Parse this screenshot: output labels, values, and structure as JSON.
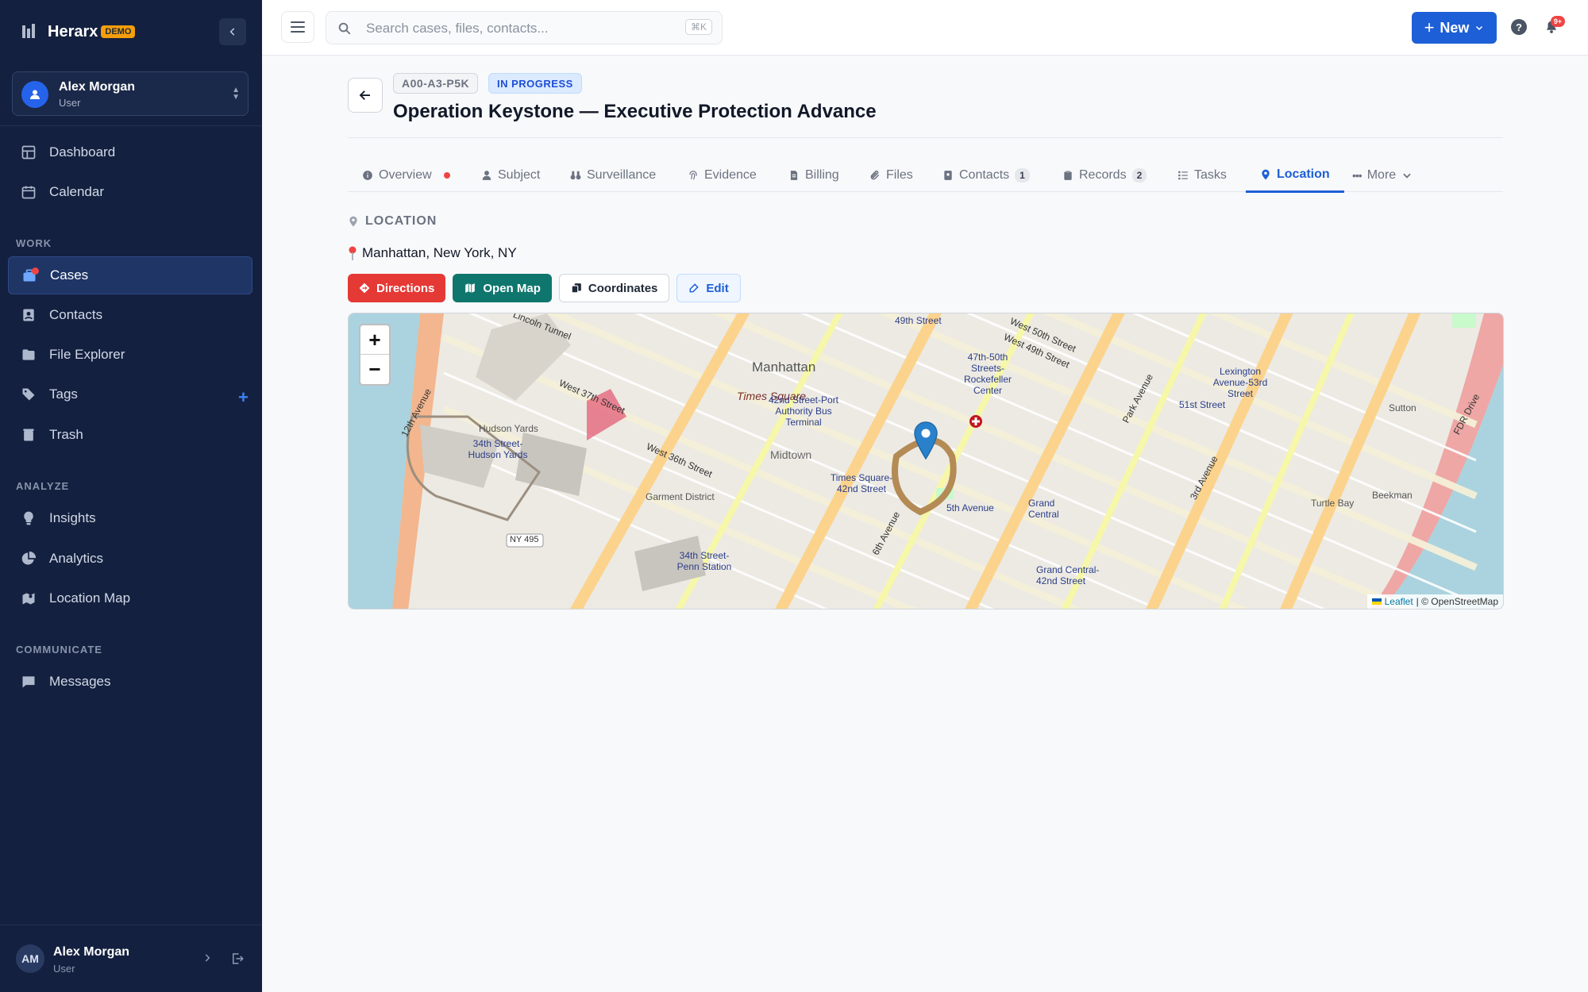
{
  "app": {
    "name": "Herarx",
    "badge": "DEMO"
  },
  "user": {
    "name": "Alex Morgan",
    "role": "User",
    "initials": "AM"
  },
  "nav": {
    "main": [
      {
        "label": "Dashboard",
        "icon": "dashboard-icon"
      },
      {
        "label": "Calendar",
        "icon": "calendar-icon"
      }
    ],
    "work_label": "WORK",
    "work": [
      {
        "label": "Cases",
        "icon": "cases-icon",
        "active": true
      },
      {
        "label": "Contacts",
        "icon": "contacts-icon"
      },
      {
        "label": "File Explorer",
        "icon": "folder-icon"
      },
      {
        "label": "Tags",
        "icon": "tags-icon"
      },
      {
        "label": "Trash",
        "icon": "trash-icon"
      }
    ],
    "analyze_label": "ANALYZE",
    "analyze": [
      {
        "label": "Insights",
        "icon": "lightbulb-icon"
      },
      {
        "label": "Analytics",
        "icon": "pie-chart-icon"
      },
      {
        "label": "Location Map",
        "icon": "map-icon"
      }
    ],
    "communicate_label": "COMMUNICATE",
    "communicate": [
      {
        "label": "Messages",
        "icon": "message-icon"
      }
    ]
  },
  "topbar": {
    "search_placeholder": "Search cases, files, contacts...",
    "search_shortcut": "⌘K",
    "new_label": "New",
    "help_label": "?",
    "notifications_badge": "9+"
  },
  "case": {
    "id": "A00-A3-P5K",
    "status": "IN PROGRESS",
    "title": "Operation Keystone — Executive Protection Advance"
  },
  "tabs": [
    {
      "label": "Overview",
      "dot": true
    },
    {
      "label": "Subject"
    },
    {
      "label": "Surveillance"
    },
    {
      "label": "Evidence"
    },
    {
      "label": "Billing"
    },
    {
      "label": "Files"
    },
    {
      "label": "Contacts",
      "count": "1"
    },
    {
      "label": "Records",
      "count": "2"
    },
    {
      "label": "Tasks"
    },
    {
      "label": "Location",
      "active": true
    },
    {
      "label": "More"
    }
  ],
  "location": {
    "heading": "LOCATION",
    "address": "Manhattan, New York, NY",
    "actions": {
      "directions": "Directions",
      "open_map": "Open Map",
      "coordinates": "Coordinates",
      "edit": "Edit"
    }
  },
  "map": {
    "zoom_in": "+",
    "zoom_out": "−",
    "attribution_leaflet": "Leaflet",
    "attribution_osm": "| © OpenStreetMap",
    "labels": [
      "Manhattan",
      "Times Square",
      "Midtown",
      "Hudson Yards",
      "34th Street-Hudson Yards",
      "Garment District",
      "Grand Central",
      "Grand Central-42nd Street",
      "Turtle Bay",
      "Beekman",
      "Sutton",
      "Lexington Avenue-53rd Street",
      "51st Street",
      "47th-50th Streets-Rockefeller Center",
      "42nd Street-Port Authority Bus Terminal",
      "Times Square-42nd Street",
      "34th Street-Penn Station",
      "5th Avenue",
      "Lincoln Tunnel",
      "NY 495",
      "49th Street",
      "West 37th Street",
      "West 36th Street",
      "12th Avenue",
      "Park Avenue",
      "3rd Avenue",
      "6th Avenue",
      "FDR Drive",
      "West 50th Street",
      "West 49th Street"
    ]
  }
}
